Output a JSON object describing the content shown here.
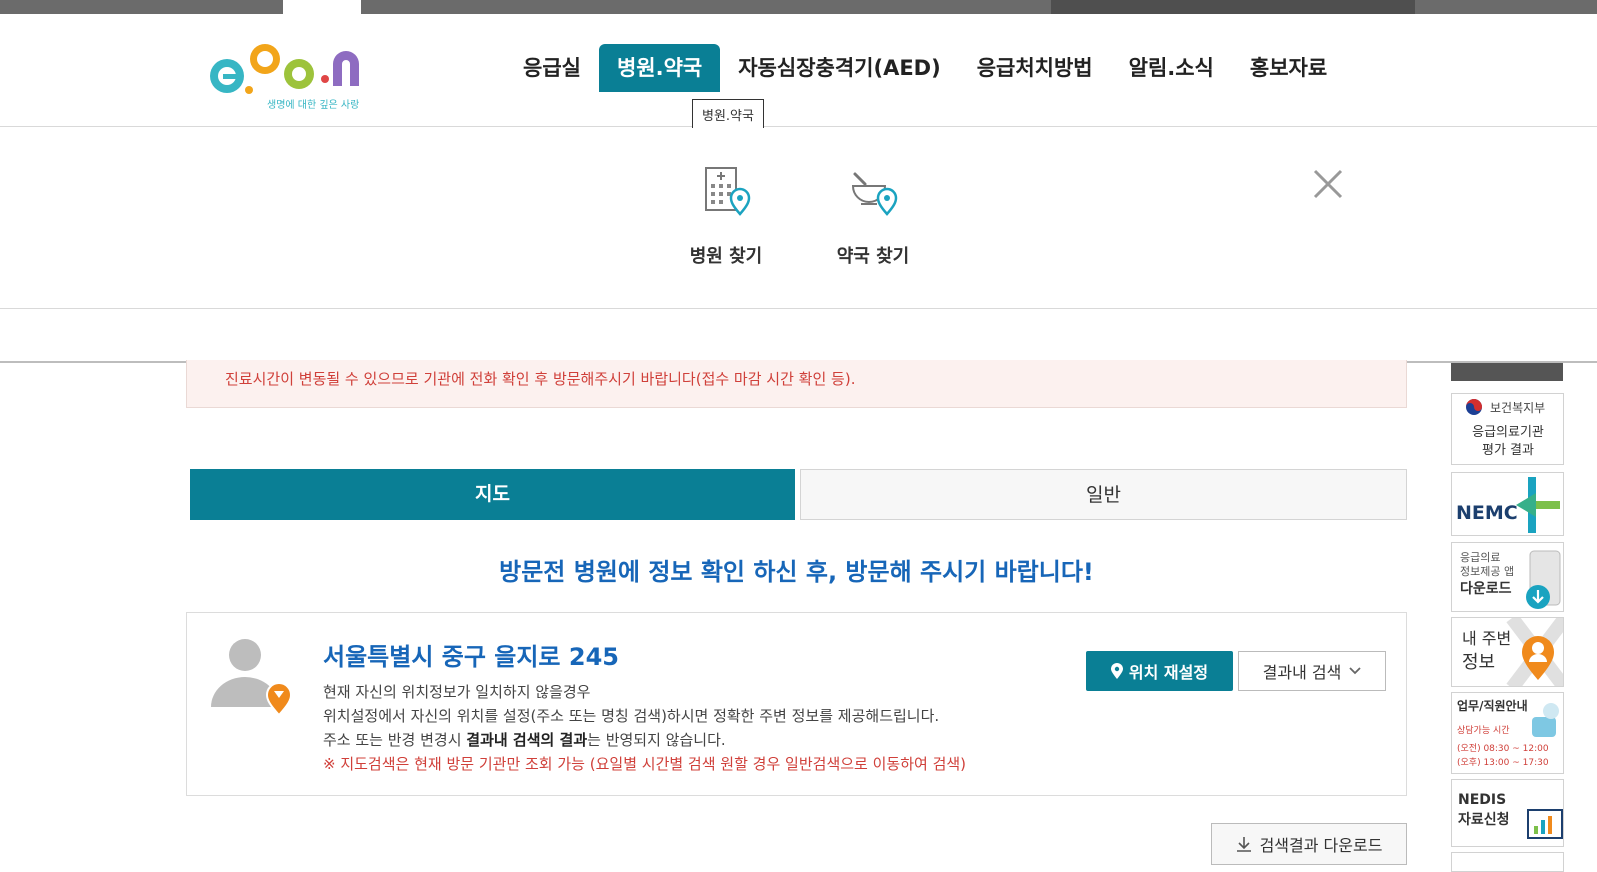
{
  "header": {
    "logo_tagline": "생명에 대한 깊은 사랑",
    "nav": [
      {
        "label": "응급실"
      },
      {
        "label": "병원.약국",
        "active": true
      },
      {
        "label": "자동심장충격기(AED)"
      },
      {
        "label": "응급처치방법"
      },
      {
        "label": "알림.소식"
      },
      {
        "label": "홍보자료"
      }
    ],
    "tooltip": "병원.약국"
  },
  "dropdown": {
    "items": [
      {
        "label": "병원 찾기",
        "icon": "hospital-location-icon"
      },
      {
        "label": "약국 찾기",
        "icon": "pharmacy-location-icon"
      }
    ],
    "close_icon": "close-icon"
  },
  "notice": {
    "text": "진료시간이 변동될 수 있으므로 기관에 전화 확인 후 방문해주시기 바랍니다(접수 마감 시간 확인 등)."
  },
  "tabs": {
    "map": "지도",
    "general": "일반"
  },
  "headline": "방문전 병원에 정보 확인 하신 후, 방문해 주시기 바랍니다!",
  "location": {
    "address": "서울특별시 중구 을지로 245",
    "line1": "현재 자신의 위치정보가 일치하지 않을경우",
    "line2": "위치설정에서 자신의 위치를 설정(주소 또는 명칭 검색)하시면 정확한 주변 정보를 제공해드립니다.",
    "line3_pre": "주소 또는 반경 변경시 ",
    "line3_bold": "결과내 검색의 결과",
    "line3_post": "는 반영되지 않습니다.",
    "warning": "※ 지도검색은 현재 방문 기관만 조회 가능 (요일별 시간별 검색 원할 경우 일반검색으로 이동하여 검색)",
    "reset_button": "위치 재설정",
    "search_button": "결과내 검색"
  },
  "download_button": "검색결과 다운로드",
  "side_banners": {
    "mohw": {
      "org": "보건복지부",
      "line1": "응급의료기관",
      "line2": "평가 결과"
    },
    "nemc": {
      "text": "NEMC"
    },
    "app": {
      "line1": "응급의료",
      "line2": "정보제공 앱",
      "line3": "다운로드"
    },
    "nearby": {
      "line1": "내 주변",
      "line2": "정보"
    },
    "work": {
      "title": "업무/직원안내",
      "hours_label": "상담가능 시간",
      "am": "(오전) 08:30 ~ 12:00",
      "pm": "(오후) 13:00 ~ 17:30"
    },
    "nedis": {
      "line1": "NEDIS",
      "line2": "자료신청"
    }
  },
  "colors": {
    "primary": "#0a7f95",
    "headline_blue": "#1766b8",
    "warning_red": "#d0403a"
  }
}
